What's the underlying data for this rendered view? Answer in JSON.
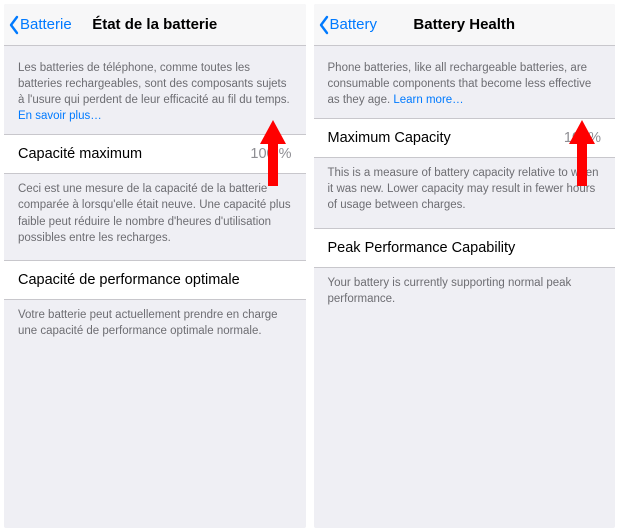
{
  "left": {
    "nav": {
      "back": "Batterie",
      "title": "État de la batterie"
    },
    "intro": {
      "text": "Les batteries de téléphone, comme toutes les batteries rechargeables, sont des composants sujets à l'usure qui perdent de leur efficacité au fil du temps. ",
      "learn_more": "En savoir plus…"
    },
    "max": {
      "label": "Capacité maximum",
      "value": "100 %",
      "footer": "Ceci est une mesure de la capacité de la batterie comparée à lorsqu'elle était neuve. Une capacité plus faible peut réduire le nombre d'heures d'utilisation possibles entre les recharges."
    },
    "perf": {
      "label": "Capacité de performance optimale",
      "footer": "Votre batterie peut actuellement prendre en charge une capacité de performance optimale normale."
    }
  },
  "right": {
    "nav": {
      "back": "Battery",
      "title": "Battery Health"
    },
    "intro": {
      "text": "Phone batteries, like all rechargeable batteries, are consumable components that become less effective as they age. ",
      "learn_more": "Learn more…"
    },
    "max": {
      "label": "Maximum Capacity",
      "value": "100%",
      "footer": "This is a measure of battery capacity relative to when it was new. Lower capacity may result in fewer hours of usage between charges."
    },
    "perf": {
      "label": "Peak Performance Capability",
      "footer": "Your battery is currently supporting normal peak performance."
    }
  }
}
